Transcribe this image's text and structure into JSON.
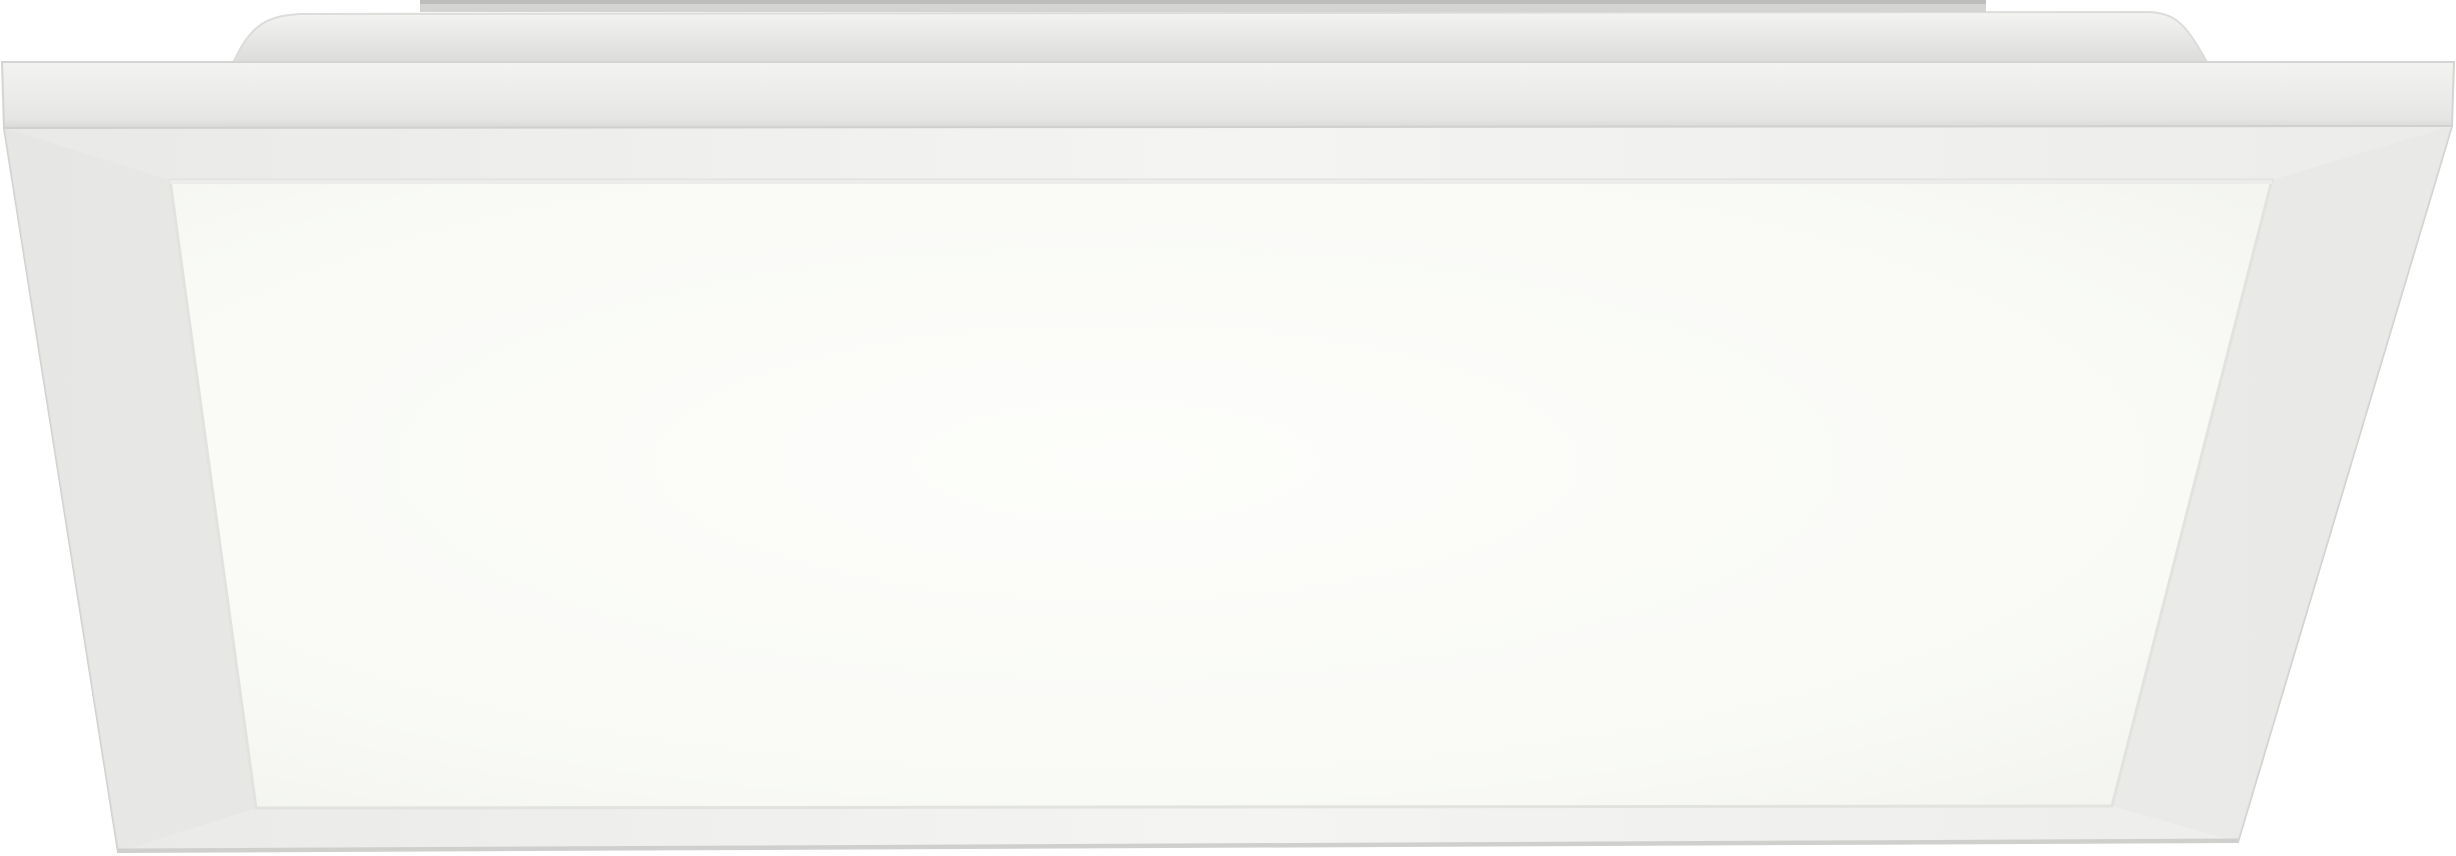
{
  "image": {
    "subject": "square-led-ceiling-panel-light",
    "background_color": "#ffffff",
    "colors": {
      "mount_top": "#eeeeec",
      "mount_side": "#d6d6d4",
      "frame_top": "#ececea",
      "frame_top_dark": "#d9d9d7",
      "frame_face": "#f1f1ef",
      "frame_face_shade": "#e6e6e4",
      "diffuser_center": "#fcfdf9",
      "diffuser_edge": "#f4f5f1",
      "outline": "#d0d0ce"
    }
  }
}
